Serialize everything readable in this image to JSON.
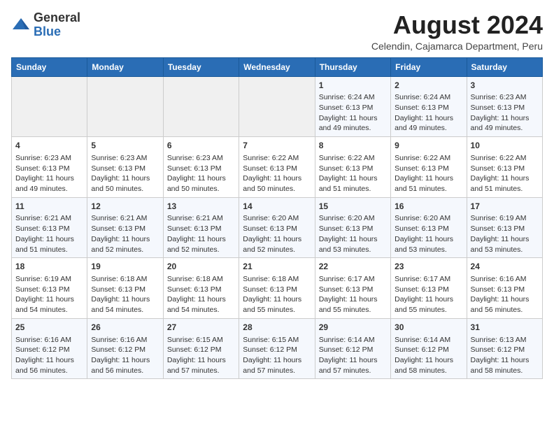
{
  "header": {
    "logo_general": "General",
    "logo_blue": "Blue",
    "month_year": "August 2024",
    "location": "Celendin, Cajamarca Department, Peru"
  },
  "calendar": {
    "days_of_week": [
      "Sunday",
      "Monday",
      "Tuesday",
      "Wednesday",
      "Thursday",
      "Friday",
      "Saturday"
    ],
    "weeks": [
      [
        {
          "day": "",
          "info": ""
        },
        {
          "day": "",
          "info": ""
        },
        {
          "day": "",
          "info": ""
        },
        {
          "day": "",
          "info": ""
        },
        {
          "day": "1",
          "info": "Sunrise: 6:24 AM\nSunset: 6:13 PM\nDaylight: 11 hours\nand 49 minutes."
        },
        {
          "day": "2",
          "info": "Sunrise: 6:24 AM\nSunset: 6:13 PM\nDaylight: 11 hours\nand 49 minutes."
        },
        {
          "day": "3",
          "info": "Sunrise: 6:23 AM\nSunset: 6:13 PM\nDaylight: 11 hours\nand 49 minutes."
        }
      ],
      [
        {
          "day": "4",
          "info": "Sunrise: 6:23 AM\nSunset: 6:13 PM\nDaylight: 11 hours\nand 49 minutes."
        },
        {
          "day": "5",
          "info": "Sunrise: 6:23 AM\nSunset: 6:13 PM\nDaylight: 11 hours\nand 50 minutes."
        },
        {
          "day": "6",
          "info": "Sunrise: 6:23 AM\nSunset: 6:13 PM\nDaylight: 11 hours\nand 50 minutes."
        },
        {
          "day": "7",
          "info": "Sunrise: 6:22 AM\nSunset: 6:13 PM\nDaylight: 11 hours\nand 50 minutes."
        },
        {
          "day": "8",
          "info": "Sunrise: 6:22 AM\nSunset: 6:13 PM\nDaylight: 11 hours\nand 51 minutes."
        },
        {
          "day": "9",
          "info": "Sunrise: 6:22 AM\nSunset: 6:13 PM\nDaylight: 11 hours\nand 51 minutes."
        },
        {
          "day": "10",
          "info": "Sunrise: 6:22 AM\nSunset: 6:13 PM\nDaylight: 11 hours\nand 51 minutes."
        }
      ],
      [
        {
          "day": "11",
          "info": "Sunrise: 6:21 AM\nSunset: 6:13 PM\nDaylight: 11 hours\nand 51 minutes."
        },
        {
          "day": "12",
          "info": "Sunrise: 6:21 AM\nSunset: 6:13 PM\nDaylight: 11 hours\nand 52 minutes."
        },
        {
          "day": "13",
          "info": "Sunrise: 6:21 AM\nSunset: 6:13 PM\nDaylight: 11 hours\nand 52 minutes."
        },
        {
          "day": "14",
          "info": "Sunrise: 6:20 AM\nSunset: 6:13 PM\nDaylight: 11 hours\nand 52 minutes."
        },
        {
          "day": "15",
          "info": "Sunrise: 6:20 AM\nSunset: 6:13 PM\nDaylight: 11 hours\nand 53 minutes."
        },
        {
          "day": "16",
          "info": "Sunrise: 6:20 AM\nSunset: 6:13 PM\nDaylight: 11 hours\nand 53 minutes."
        },
        {
          "day": "17",
          "info": "Sunrise: 6:19 AM\nSunset: 6:13 PM\nDaylight: 11 hours\nand 53 minutes."
        }
      ],
      [
        {
          "day": "18",
          "info": "Sunrise: 6:19 AM\nSunset: 6:13 PM\nDaylight: 11 hours\nand 54 minutes."
        },
        {
          "day": "19",
          "info": "Sunrise: 6:18 AM\nSunset: 6:13 PM\nDaylight: 11 hours\nand 54 minutes."
        },
        {
          "day": "20",
          "info": "Sunrise: 6:18 AM\nSunset: 6:13 PM\nDaylight: 11 hours\nand 54 minutes."
        },
        {
          "day": "21",
          "info": "Sunrise: 6:18 AM\nSunset: 6:13 PM\nDaylight: 11 hours\nand 55 minutes."
        },
        {
          "day": "22",
          "info": "Sunrise: 6:17 AM\nSunset: 6:13 PM\nDaylight: 11 hours\nand 55 minutes."
        },
        {
          "day": "23",
          "info": "Sunrise: 6:17 AM\nSunset: 6:13 PM\nDaylight: 11 hours\nand 55 minutes."
        },
        {
          "day": "24",
          "info": "Sunrise: 6:16 AM\nSunset: 6:13 PM\nDaylight: 11 hours\nand 56 minutes."
        }
      ],
      [
        {
          "day": "25",
          "info": "Sunrise: 6:16 AM\nSunset: 6:12 PM\nDaylight: 11 hours\nand 56 minutes."
        },
        {
          "day": "26",
          "info": "Sunrise: 6:16 AM\nSunset: 6:12 PM\nDaylight: 11 hours\nand 56 minutes."
        },
        {
          "day": "27",
          "info": "Sunrise: 6:15 AM\nSunset: 6:12 PM\nDaylight: 11 hours\nand 57 minutes."
        },
        {
          "day": "28",
          "info": "Sunrise: 6:15 AM\nSunset: 6:12 PM\nDaylight: 11 hours\nand 57 minutes."
        },
        {
          "day": "29",
          "info": "Sunrise: 6:14 AM\nSunset: 6:12 PM\nDaylight: 11 hours\nand 57 minutes."
        },
        {
          "day": "30",
          "info": "Sunrise: 6:14 AM\nSunset: 6:12 PM\nDaylight: 11 hours\nand 58 minutes."
        },
        {
          "day": "31",
          "info": "Sunrise: 6:13 AM\nSunset: 6:12 PM\nDaylight: 11 hours\nand 58 minutes."
        }
      ]
    ]
  }
}
